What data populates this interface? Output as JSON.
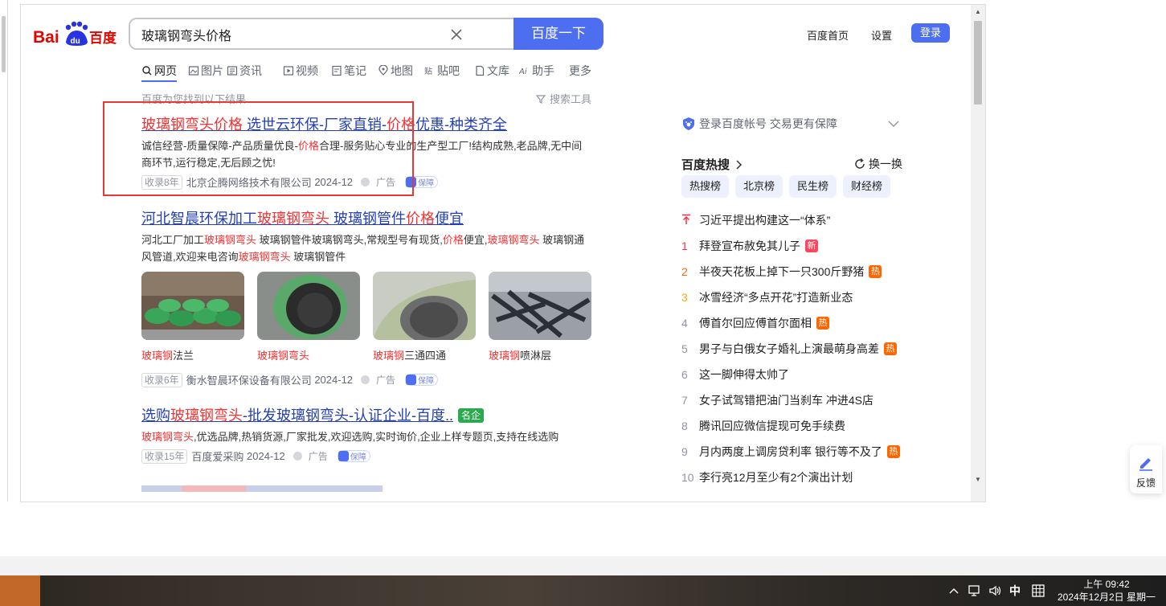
{
  "header": {
    "search_query": "玻璃钢弯头价格",
    "search_button": "百度一下",
    "links": {
      "home": "百度首页",
      "settings": "设置",
      "login": "登录"
    }
  },
  "tabs": [
    {
      "label": "网页",
      "icon": "search-icon"
    },
    {
      "label": "图片",
      "icon": "image-icon"
    },
    {
      "label": "资讯",
      "icon": "news-icon"
    },
    {
      "label": "视频",
      "icon": "video-icon"
    },
    {
      "label": "笔记",
      "icon": "note-icon"
    },
    {
      "label": "地图",
      "icon": "map-icon"
    },
    {
      "label": "贴吧",
      "icon": "tieba-icon"
    },
    {
      "label": "文库",
      "icon": "doc-icon"
    },
    {
      "label": "助手",
      "icon": "ai-icon"
    },
    {
      "label": "更多",
      "icon": ""
    }
  ],
  "result_count": "百度为您找到以下结果",
  "search_tools": "搜索工具",
  "results": [
    {
      "title_parts": [
        {
          "t": "玻璃钢弯头价格",
          "h": true
        },
        {
          "t": " 选世云环保-厂家直销-",
          "h": false
        },
        {
          "t": "价格",
          "h": true
        },
        {
          "t": "优惠-种类齐全",
          "h": false
        }
      ],
      "desc_parts": [
        {
          "t": "诚信经营-质量保障-产品质量优良-",
          "h": false
        },
        {
          "t": "价格",
          "h": true
        },
        {
          "t": "合理-服务贴心专业的生产型工厂!结构成熟,老品牌,无中间商环节,运行稳定,无后顾之忧!",
          "h": false
        }
      ],
      "tag": "收录8年",
      "source": "北京企腾网络技术有限公司",
      "date": "2024-12",
      "ad": "广告",
      "guarantee": "保障"
    },
    {
      "title_parts": [
        {
          "t": "河北智晨环保加工",
          "h": false
        },
        {
          "t": "玻璃钢弯头",
          "h": true
        },
        {
          "t": " 玻璃钢管件",
          "h": false
        },
        {
          "t": "价格",
          "h": true
        },
        {
          "t": "便宜",
          "h": false
        }
      ],
      "desc_parts": [
        {
          "t": "河北工厂加工",
          "h": false
        },
        {
          "t": "玻璃钢弯头",
          "h": true
        },
        {
          "t": " 玻璃钢管件玻璃钢弯头,常规型号有现货,",
          "h": false
        },
        {
          "t": "价格",
          "h": true
        },
        {
          "t": "便宜,",
          "h": false
        },
        {
          "t": "玻璃钢弯头",
          "h": true
        },
        {
          "t": " 玻璃钢通风管道,欢迎来电咨询",
          "h": false
        },
        {
          "t": "玻璃钢弯头",
          "h": true
        },
        {
          "t": " 玻璃钢管件",
          "h": false
        }
      ],
      "images": [
        {
          "cap_hl": "玻璃钢",
          "cap_rest": "法兰"
        },
        {
          "cap_hl": "玻璃钢弯头",
          "cap_rest": ""
        },
        {
          "cap_hl": "玻璃钢",
          "cap_rest": "三通四通"
        },
        {
          "cap_hl": "玻璃钢",
          "cap_rest": "喷淋层"
        }
      ],
      "tag": "收录6年",
      "source": "衡水智晨环保设备有限公司",
      "date": "2024-12",
      "ad": "广告",
      "guarantee": "保障"
    },
    {
      "title_parts": [
        {
          "t": "选购",
          "h": false
        },
        {
          "t": "玻璃钢弯头",
          "h": true
        },
        {
          "t": "-批发玻璃钢弯头-认证企业-百度..",
          "h": false
        }
      ],
      "badge": "名企",
      "desc_parts": [
        {
          "t": "玻璃钢弯头",
          "h": true
        },
        {
          "t": ",优选品牌,热销货源,厂家批发,欢迎选购,实时询价,企业上样专题页,支持在线选购",
          "h": false
        }
      ],
      "tag": "收录15年",
      "source": "百度爱采购",
      "date": "2024-12",
      "ad": "广告",
      "guarantee": "保障"
    }
  ],
  "right_panel": {
    "login_tip": "登录百度帐号 交易更有保障",
    "hot_title": "百度热搜",
    "refresh": "换一换",
    "hot_tabs": [
      "热搜榜",
      "北京榜",
      "民生榜",
      "财经榜"
    ],
    "hot_items": [
      {
        "rank": "",
        "text": "习近平提出构建这一“体系”",
        "badge": "",
        "top": true
      },
      {
        "rank": "1",
        "text": "拜登宣布赦免其儿子",
        "badge": "新"
      },
      {
        "rank": "2",
        "text": "半夜天花板上掉下一只300斤野猪",
        "badge": "热"
      },
      {
        "rank": "3",
        "text": "冰雪经济“多点开花”打造新业态",
        "badge": ""
      },
      {
        "rank": "4",
        "text": "傅首尔回应傅首尔面相",
        "badge": "热"
      },
      {
        "rank": "5",
        "text": "男子与白俄女子婚礼上演最萌身高差",
        "badge": "热"
      },
      {
        "rank": "6",
        "text": "这一脚伸得太帅了",
        "badge": ""
      },
      {
        "rank": "7",
        "text": "女子试驾错把油门当刹车 冲进4S店",
        "badge": ""
      },
      {
        "rank": "8",
        "text": "腾讯回应微信提现可免手续费",
        "badge": ""
      },
      {
        "rank": "9",
        "text": "月内两度上调房贷利率 银行等不及了",
        "badge": "热"
      },
      {
        "rank": "10",
        "text": "李行亮12月至少有2个演出计划",
        "badge": ""
      }
    ]
  },
  "feedback": "反馈",
  "taskbar": {
    "ime": "中",
    "time": "上午 09:42",
    "date": "2024年12月2日 星期一"
  },
  "colors": {
    "accent": "#4e6ef2",
    "link": "#2440b3",
    "highlight": "#f73131",
    "annotation_box": "#e53935"
  }
}
